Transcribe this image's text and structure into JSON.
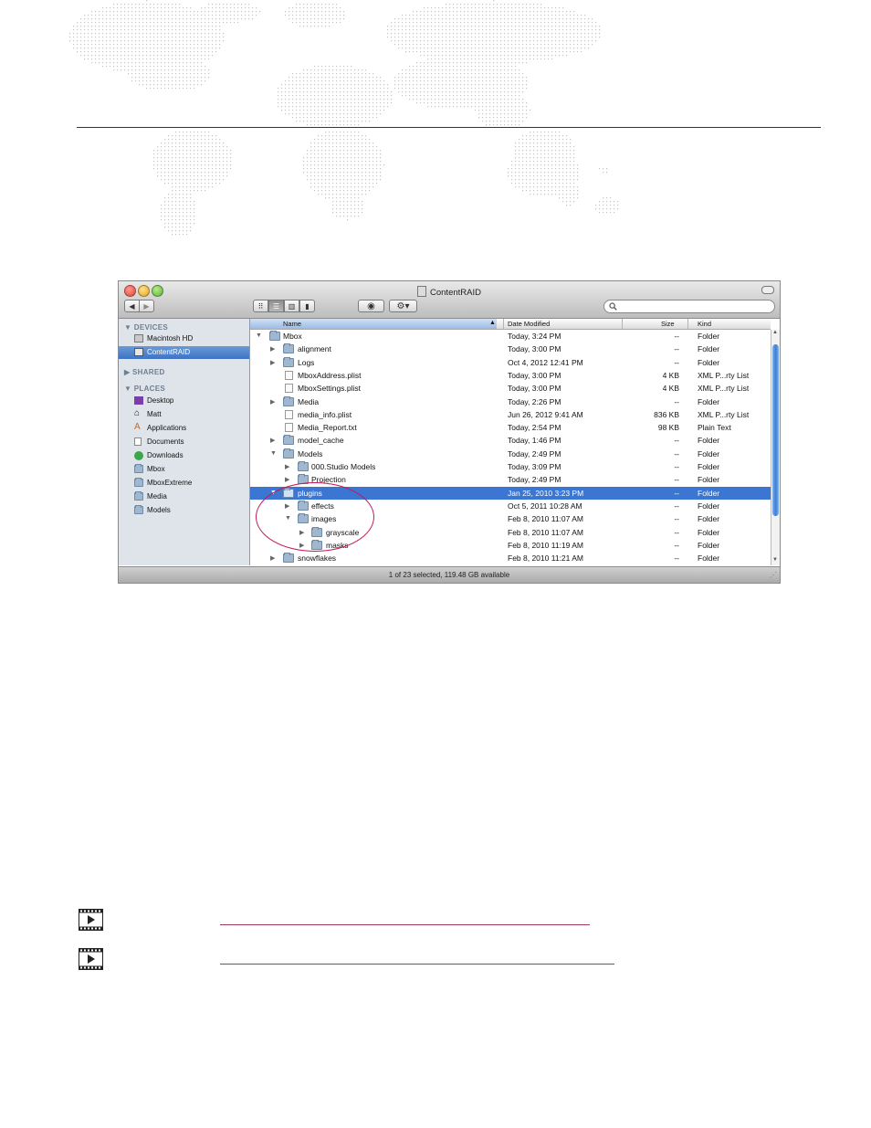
{
  "window": {
    "title": "ContentRAID",
    "status": "1 of 23 selected, 119.48 GB available",
    "accent": "#3b76d3"
  },
  "sidebar": {
    "sections": [
      {
        "label": "DEVICES"
      },
      {
        "label": "SHARED"
      },
      {
        "label": "PLACES"
      }
    ],
    "items": [
      {
        "label": "Macintosh HD",
        "icon": "hard-drive-icon"
      },
      {
        "label": "ContentRAID",
        "icon": "hard-drive-icon",
        "selected": true
      },
      {
        "label": "Desktop",
        "icon": "desktop-icon"
      },
      {
        "label": "Matt",
        "icon": "home-icon"
      },
      {
        "label": "Applications",
        "icon": "applications-icon"
      },
      {
        "label": "Documents",
        "icon": "documents-icon"
      },
      {
        "label": "Downloads",
        "icon": "downloads-icon"
      },
      {
        "label": "Mbox",
        "icon": "folder-icon"
      },
      {
        "label": "MboxExtreme",
        "icon": "folder-icon"
      },
      {
        "label": "Media",
        "icon": "folder-icon"
      },
      {
        "label": "Models",
        "icon": "folder-icon"
      }
    ]
  },
  "columns": {
    "name": "Name",
    "date": "Date Modified",
    "size": "Size",
    "kind": "Kind"
  },
  "rows": [
    {
      "name": "Mbox",
      "date": "Today, 3:24 PM",
      "size": "--",
      "kind": "Folder"
    },
    {
      "name": "alignment",
      "date": "Today, 3:00 PM",
      "size": "--",
      "kind": "Folder"
    },
    {
      "name": "Logs",
      "date": "Oct 4, 2012 12:41 PM",
      "size": "--",
      "kind": "Folder"
    },
    {
      "name": "MboxAddress.plist",
      "date": "Today, 3:00 PM",
      "size": "4 KB",
      "kind": "XML P...rty List"
    },
    {
      "name": "MboxSettings.plist",
      "date": "Today, 3:00 PM",
      "size": "4 KB",
      "kind": "XML P...rty List"
    },
    {
      "name": "Media",
      "date": "Today, 2:26 PM",
      "size": "--",
      "kind": "Folder"
    },
    {
      "name": "media_info.plist",
      "date": "Jun 26, 2012 9:41 AM",
      "size": "836 KB",
      "kind": "XML P...rty List"
    },
    {
      "name": "Media_Report.txt",
      "date": "Today, 2:54 PM",
      "size": "98 KB",
      "kind": "Plain Text"
    },
    {
      "name": "model_cache",
      "date": "Today, 1:46 PM",
      "size": "--",
      "kind": "Folder"
    },
    {
      "name": "Models",
      "date": "Today, 2:49 PM",
      "size": "--",
      "kind": "Folder"
    },
    {
      "name": "000.Studio Models",
      "date": "Today, 3:09 PM",
      "size": "--",
      "kind": "Folder"
    },
    {
      "name": "Projection",
      "date": "Today, 2:49 PM",
      "size": "--",
      "kind": "Folder"
    },
    {
      "name": "plugins",
      "date": "Jan 25, 2010 3:23 PM",
      "size": "--",
      "kind": "Folder"
    },
    {
      "name": "effects",
      "date": "Oct 5, 2011 10:28 AM",
      "size": "--",
      "kind": "Folder"
    },
    {
      "name": "images",
      "date": "Feb 8, 2010 11:07 AM",
      "size": "--",
      "kind": "Folder"
    },
    {
      "name": "grayscale",
      "date": "Feb 8, 2010 11:07 AM",
      "size": "--",
      "kind": "Folder"
    },
    {
      "name": "masks",
      "date": "Feb 8, 2010 11:19 AM",
      "size": "--",
      "kind": "Folder"
    },
    {
      "name": "snowflakes",
      "date": "Feb 8, 2010 11:21 AM",
      "size": "--",
      "kind": "Folder"
    }
  ]
}
